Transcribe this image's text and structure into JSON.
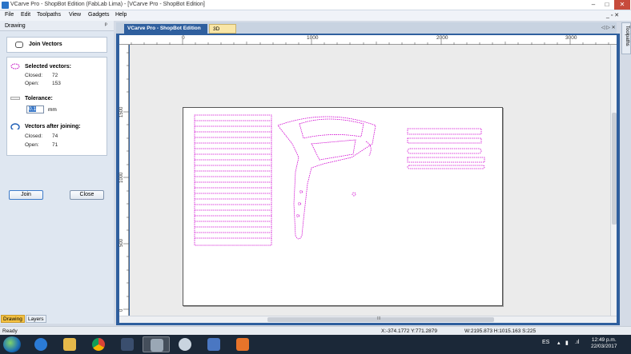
{
  "window": {
    "title": "VCarve Pro - ShopBot Edition (FabLab Lima) - [VCarve Pro - ShopBot Edition]",
    "controls": {
      "minimize": "–",
      "maximize": "□",
      "close": "✕"
    }
  },
  "menubar": {
    "items": [
      "File",
      "Edit",
      "Toolpaths",
      "View",
      "Gadgets",
      "Help"
    ],
    "mdi_controls": "_ ▫ ✕"
  },
  "left_panel": {
    "header": "Drawing",
    "pin": "ᵖ",
    "tool_title": "Join Vectors",
    "selected": {
      "label": "Selected vectors:",
      "closed_label": "Closed:",
      "closed_value": "72",
      "open_label": "Open:",
      "open_value": "153"
    },
    "tolerance": {
      "label": "Tolerance:",
      "value": "0.1",
      "unit": "mm"
    },
    "after": {
      "label": "Vectors after joining:",
      "closed_label": "Closed:",
      "closed_value": "74",
      "open_label": "Open:",
      "open_value": "71"
    },
    "join_button": "Join",
    "close_button": "Close",
    "bottom_tabs": [
      "Drawing",
      "Layers"
    ]
  },
  "document": {
    "tabs": [
      "VCarve Pro - ShopBot Edition",
      "3D View"
    ],
    "nav": "◁ ▷ ✕",
    "ruler_top": [
      "0",
      "1000",
      "2000",
      "3000"
    ],
    "ruler_left": [
      "1500",
      "1000",
      "500",
      "0"
    ],
    "scroll_grip": "III"
  },
  "right_tab": "Toolpaths",
  "status": {
    "ready": "Ready",
    "coords": "X:-374.1772 Y:771.2879",
    "size": "W:2195.873  H:1015.163  S:225"
  },
  "taskbar": {
    "lang": "ES",
    "time": "12:49 p.m.",
    "date": "22/03/2017"
  },
  "colors": {
    "accent": "#2f5f9e",
    "vector": "#d000d0",
    "active_tab": "#f5c242"
  }
}
